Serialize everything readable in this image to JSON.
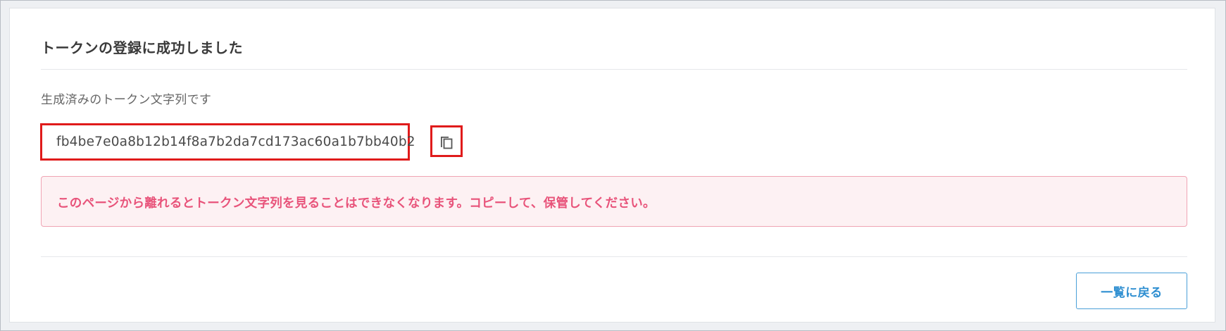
{
  "page": {
    "title": "トークンの登録に成功しました",
    "description": "生成済みのトークン文字列です"
  },
  "token": {
    "value": "fb4be7e0a8b12b14f8a7b2da7cd173ac60a1b7bb40b2",
    "copy_icon": "copy-icon"
  },
  "alert": {
    "message": "このページから離れるとトークン文字列を見ることはできなくなります。コピーして、保管してください。"
  },
  "actions": {
    "back_label": "一覧に戻る"
  },
  "colors": {
    "highlight": "#e01b1b",
    "alert_text": "#e8537a",
    "alert_bg": "#fdf1f3",
    "alert_border": "#f0a4b4",
    "primary": "#2f8fd1"
  }
}
